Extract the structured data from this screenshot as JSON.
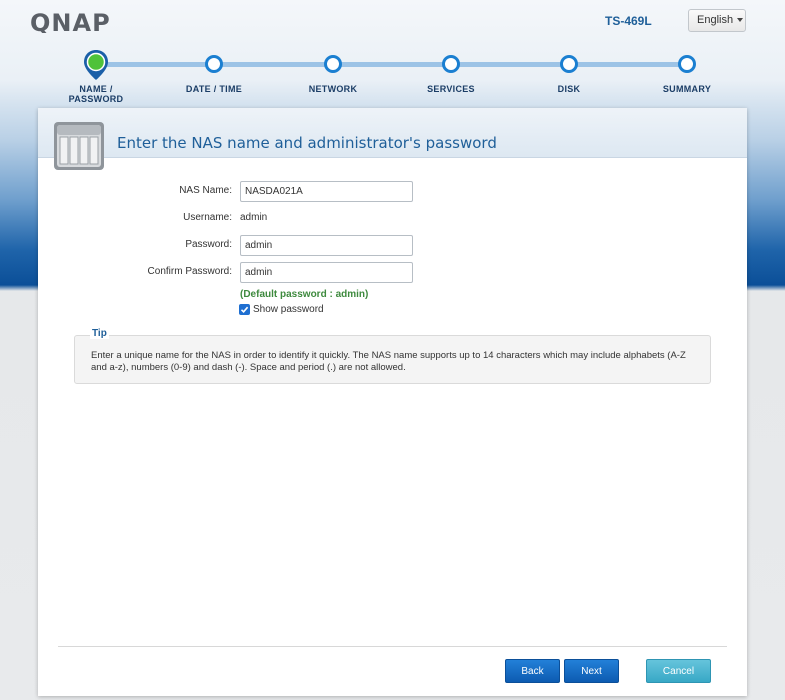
{
  "header": {
    "logo_text": "QNAP",
    "model": "TS-469L",
    "language": "English"
  },
  "steps": [
    {
      "label": "NAME /\nPASSWORD",
      "active": true
    },
    {
      "label": "DATE / TIME",
      "active": false
    },
    {
      "label": "NETWORK",
      "active": false
    },
    {
      "label": "SERVICES",
      "active": false
    },
    {
      "label": "DISK",
      "active": false
    },
    {
      "label": "SUMMARY",
      "active": false
    }
  ],
  "panel": {
    "title": "Enter the NAS name and administrator's password"
  },
  "form": {
    "nas_name_label": "NAS Name:",
    "nas_name_value": "NASDA021A",
    "username_label": "Username:",
    "username_value": "admin",
    "password_label": "Password:",
    "password_value": "admin",
    "confirm_label": "Confirm Password:",
    "confirm_value": "admin",
    "default_password_note": "(Default password : admin)",
    "show_password_label": "Show password",
    "show_password_checked": true
  },
  "tip": {
    "title": "Tip",
    "text": "Enter a unique name for the NAS in order to identify it quickly. The NAS name supports up to 14 characters which may include alphabets (A-Z and a-z), numbers (0-9) and dash (-). Space and period (.) are not allowed."
  },
  "buttons": {
    "back": "Back",
    "next": "Next",
    "cancel": "Cancel"
  },
  "colors": {
    "accent": "#1b7fd1",
    "title": "#1f5f99",
    "default_note": "#3e8a3e",
    "cancel": "#38a8c6"
  },
  "icons": [
    "qnap-logo",
    "nas-device-icon",
    "location-pin-icon",
    "checkmark-icon",
    "caret-down-icon"
  ]
}
